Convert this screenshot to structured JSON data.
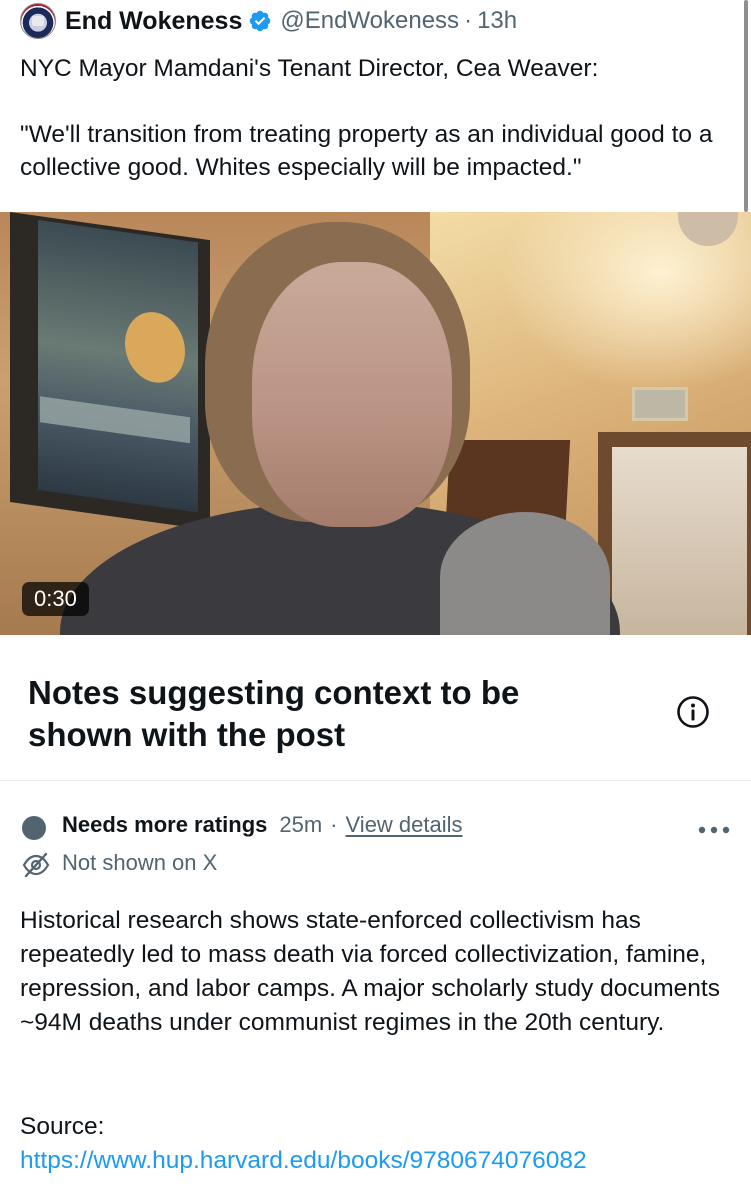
{
  "post": {
    "display_name": "End Wokeness",
    "handle": "@EndWokeness",
    "separator": "·",
    "time": "13h",
    "text_line1": "NYC Mayor Mamdani's Tenant Director, Cea Weaver:",
    "text_quote": "\"We'll transition from treating property as an individual good to a collective good. Whites especially will be impacted.\"",
    "verified_color": "#1d9bf0",
    "avatar_icon": "eagle-flag-avatar"
  },
  "video": {
    "duration": "0:30"
  },
  "notes": {
    "title": "Notes suggesting context to be shown with the post",
    "info_icon": "info-circle-icon"
  },
  "note": {
    "status": "Needs more ratings",
    "time": "25m",
    "separator": "·",
    "view_details": "View details",
    "visibility": "Not shown on X",
    "body": "Historical research shows state-enforced collectivism has repeatedly led to mass death via forced collectivization, famine, repression, and labor camps. A major scholarly study documents ~94M deaths under communist regimes in the 20th century.",
    "source_label": "Source:",
    "source_url": "https://www.hup.harvard.edu/books/9780674076082",
    "link_color": "#1d9bf0",
    "muted_color": "#536471"
  }
}
